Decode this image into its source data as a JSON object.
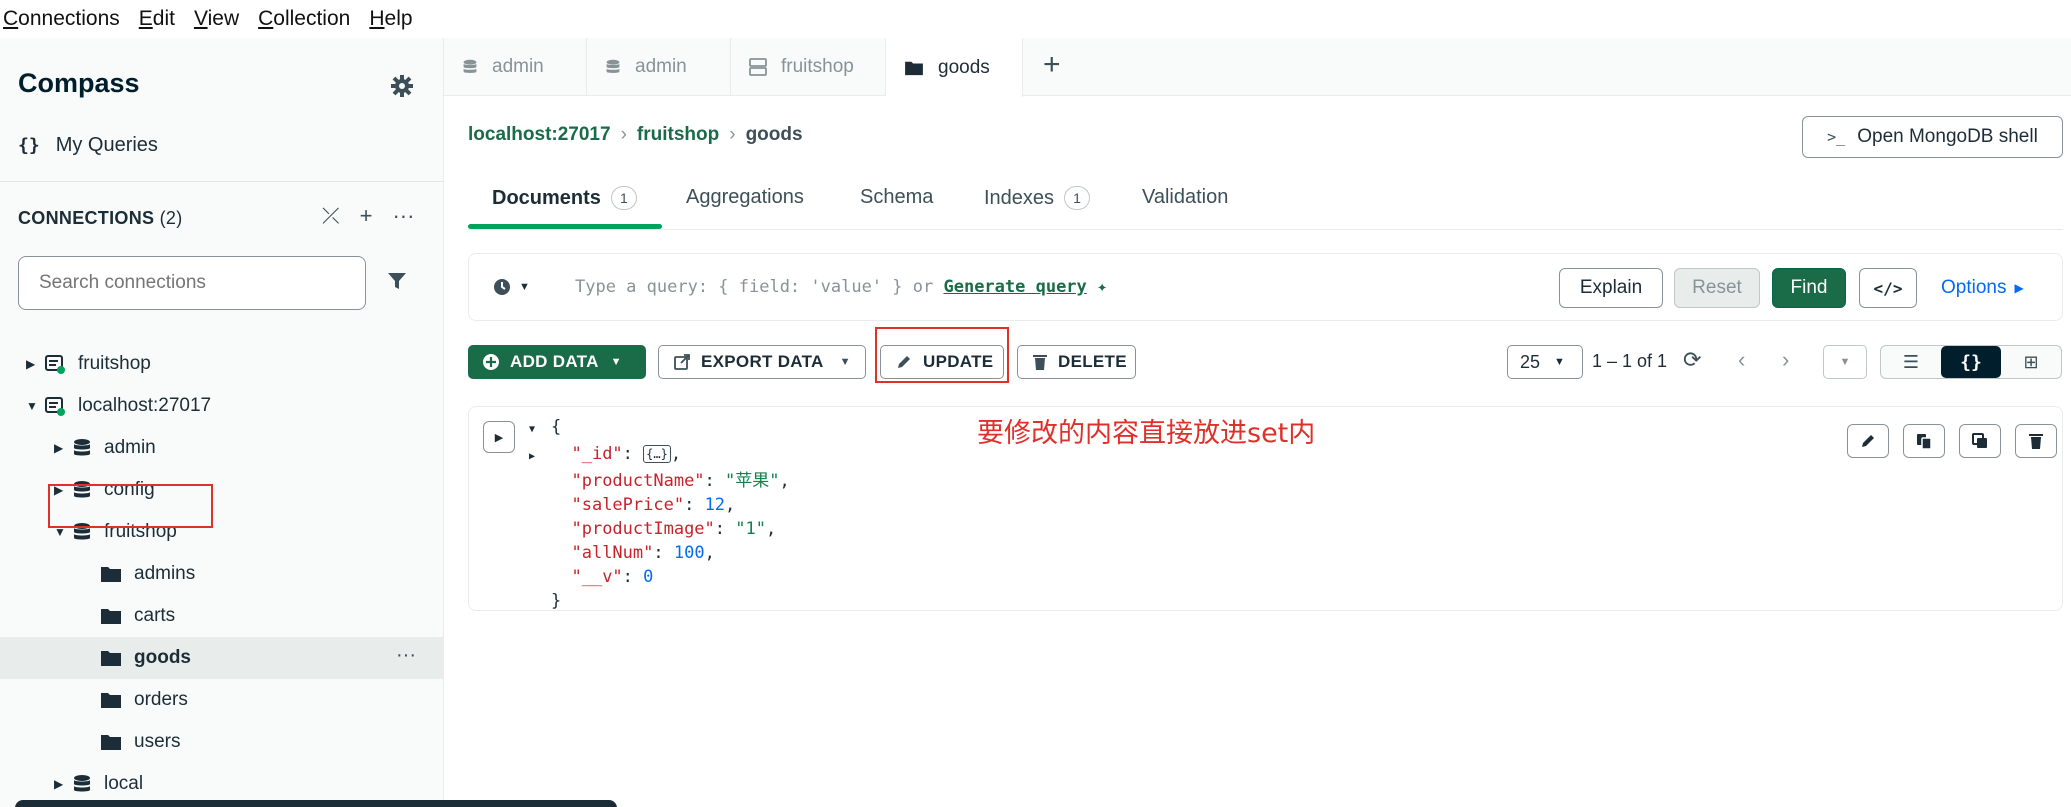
{
  "menu": [
    "Connections",
    "Edit",
    "View",
    "Collection",
    "Help"
  ],
  "sidebar": {
    "brand": "Compass",
    "my_queries": "My Queries",
    "connections_label": "CONNECTIONS",
    "connections_count": "(2)",
    "search_placeholder": "Search connections",
    "tree": [
      {
        "label": "fruitshop",
        "type": "connection"
      },
      {
        "label": "localhost:27017",
        "type": "connection"
      },
      {
        "label": "admin",
        "type": "database"
      },
      {
        "label": "config",
        "type": "database"
      },
      {
        "label": "fruitshop",
        "type": "database"
      },
      {
        "label": "admins",
        "type": "collection"
      },
      {
        "label": "carts",
        "type": "collection"
      },
      {
        "label": "goods",
        "type": "collection",
        "selected": true
      },
      {
        "label": "orders",
        "type": "collection"
      },
      {
        "label": "users",
        "type": "collection"
      },
      {
        "label": "local",
        "type": "database"
      }
    ]
  },
  "tabs": [
    {
      "label": "admin",
      "icon": "database-icon"
    },
    {
      "label": "admin",
      "icon": "database-icon"
    },
    {
      "label": "fruitshop",
      "icon": "server-icon"
    },
    {
      "label": "goods",
      "icon": "folder-icon",
      "active": true
    }
  ],
  "breadcrumb": {
    "host": "localhost:27017",
    "db": "fruitshop",
    "collection": "goods"
  },
  "shell_button": "Open MongoDB shell",
  "subtabs": [
    {
      "label": "Documents",
      "badge": "1"
    },
    {
      "label": "Aggregations"
    },
    {
      "label": "Schema"
    },
    {
      "label": "Indexes",
      "badge": "1"
    },
    {
      "label": "Validation"
    }
  ],
  "query": {
    "placeholder": "Type a query: { field: 'value' } or",
    "generate": "Generate query",
    "explain": "Explain",
    "reset": "Reset",
    "find": "Find",
    "code": "</>",
    "options": "Options"
  },
  "actions": {
    "add": "ADD DATA",
    "export": "EXPORT DATA",
    "update": "UPDATE",
    "delete": "DELETE"
  },
  "pager": {
    "page_size": "25",
    "range": "1 – 1 of 1"
  },
  "document": {
    "open_brace": "{",
    "close_brace": "}",
    "id_key": "\"_id\"",
    "id_value": "{…}",
    "fields": [
      {
        "key": "\"productName\"",
        "value": "\"苹果\"",
        "kind": "s"
      },
      {
        "key": "\"salePrice\"",
        "value": "12",
        "kind": "n"
      },
      {
        "key": "\"productImage\"",
        "value": "\"1\"",
        "kind": "s"
      },
      {
        "key": "\"allNum\"",
        "value": "100",
        "kind": "n"
      },
      {
        "key": "\"__v\"",
        "value": "0",
        "kind": "n"
      }
    ]
  },
  "annotation": "要修改的内容直接放进set内",
  "colors": {
    "accent": "#1a6b48",
    "highlight": "#e0302a",
    "link": "#016bf8"
  }
}
